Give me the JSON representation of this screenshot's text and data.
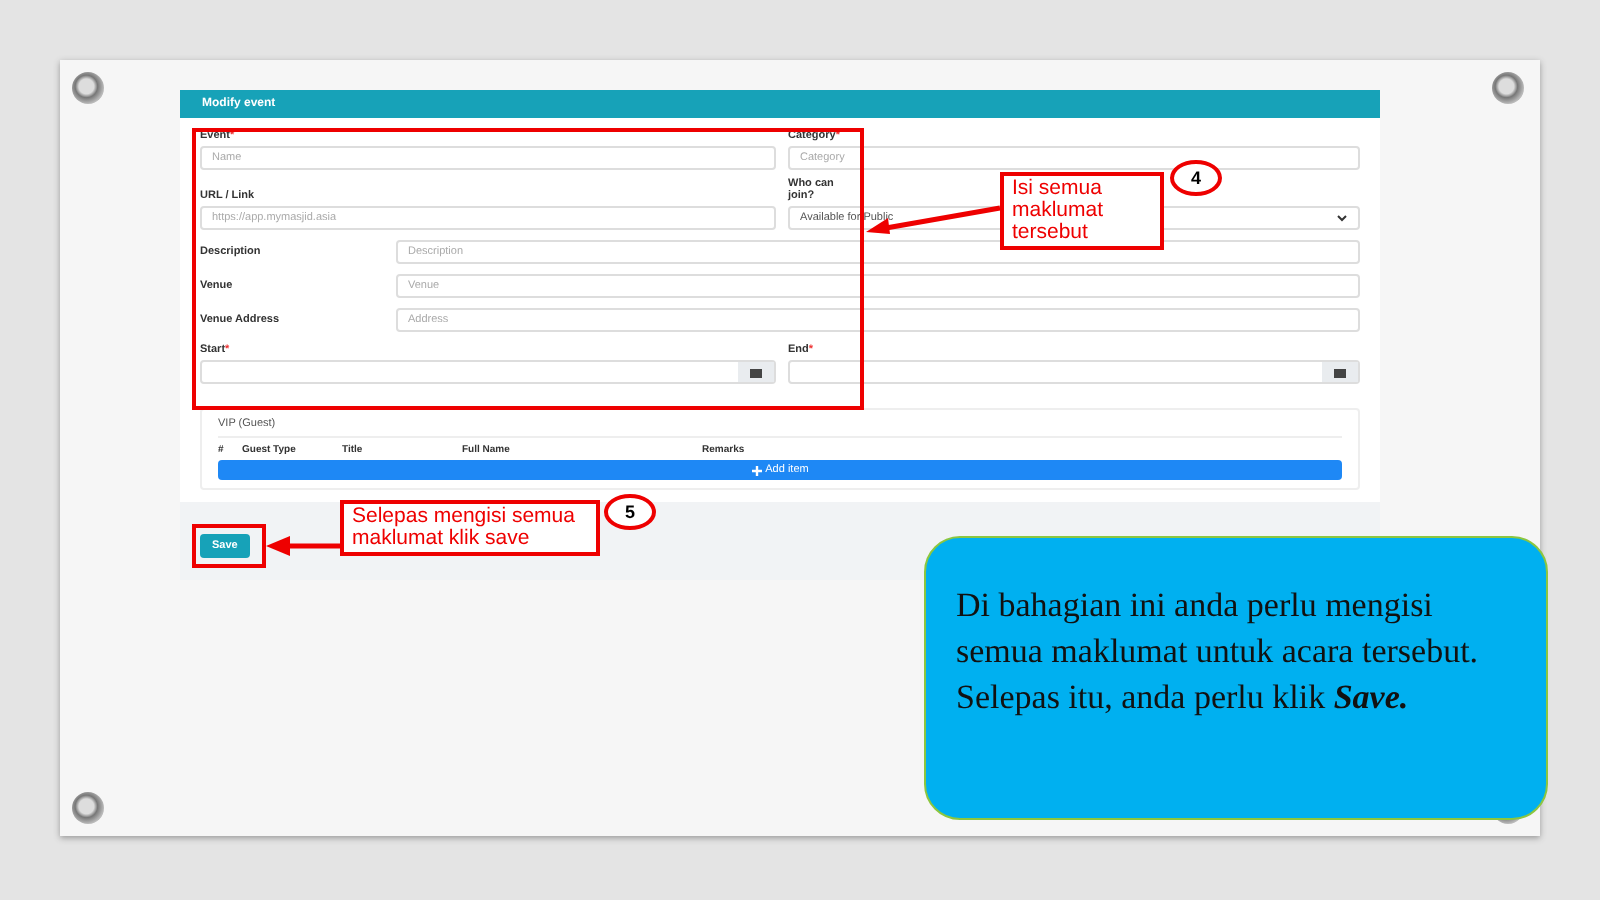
{
  "form": {
    "title": "Modify event",
    "top_fields": [
      {
        "label": "Event",
        "required_mark": "*",
        "placeholder": "Name",
        "kind": "text"
      },
      {
        "label": "URL / Link",
        "placeholder": "https://app.mymasjid.asia",
        "kind": "text"
      },
      {
        "label": "Category",
        "required_mark": "*",
        "placeholder": "Category",
        "kind": "text"
      },
      {
        "label": "Who can join?",
        "value": "Available for Public",
        "kind": "select"
      }
    ],
    "row_fields": [
      {
        "label": "Description",
        "placeholder": "Description"
      },
      {
        "label": "Venue",
        "placeholder": "Venue"
      },
      {
        "label": "Venue Address",
        "placeholder": "Address"
      }
    ],
    "date_fields": [
      {
        "label": "Start",
        "required_mark": "*"
      },
      {
        "label": "End",
        "required_mark": "*"
      }
    ],
    "guest_table": {
      "title": "VIP (Guest)",
      "columns": [
        "#",
        "Guest Type",
        "Title",
        "Full Name",
        "Remarks"
      ],
      "add_button": "Add item"
    },
    "save_button": "Save"
  },
  "callouts": [
    {
      "number": "4",
      "text": "Isi semua maklumat tersebut"
    },
    {
      "number": "5",
      "text": "Selepas mengisi semua maklumat klik save"
    }
  ],
  "info_box": {
    "text": "Di bahagian ini anda perlu mengisi semua maklumat untuk acara tersebut. Selepas itu, anda perlu klik **Save.**"
  }
}
